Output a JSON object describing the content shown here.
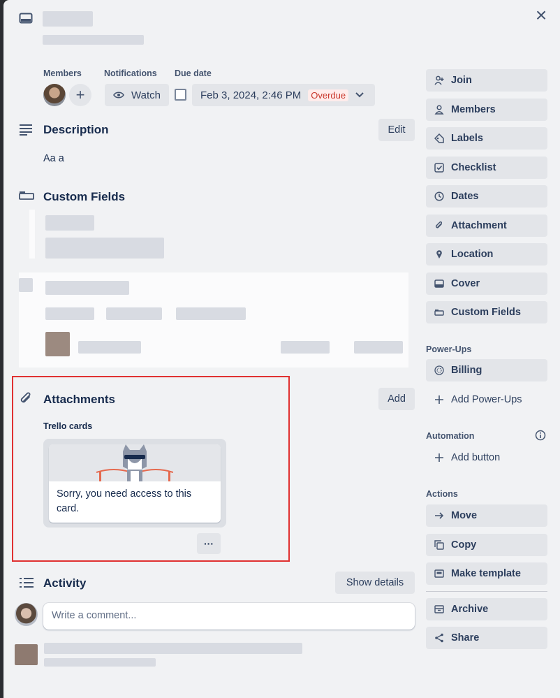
{
  "card": {
    "close_label": "×"
  },
  "header": {
    "members_label": "Members",
    "notifications_label": "Notifications",
    "due_label": "Due date",
    "watch_label": "Watch",
    "due_value": "Feb 3, 2024, 2:46 PM",
    "overdue_badge": "Overdue"
  },
  "description": {
    "title": "Description",
    "edit_label": "Edit",
    "text": "Aa a"
  },
  "custom_fields": {
    "title": "Custom Fields"
  },
  "attachments": {
    "title": "Attachments",
    "add_label": "Add",
    "group_label": "Trello cards",
    "card_message": "Sorry, you need access to this card.",
    "more_label": "···"
  },
  "activity": {
    "title": "Activity",
    "show_details_label": "Show details",
    "comment_placeholder": "Write a comment..."
  },
  "sidebar": {
    "add_to_card": [
      {
        "label": "Join",
        "icon": "add-person-icon"
      },
      {
        "label": "Members",
        "icon": "person-icon"
      },
      {
        "label": "Labels",
        "icon": "tag-icon"
      },
      {
        "label": "Checklist",
        "icon": "checkbox-icon"
      },
      {
        "label": "Dates",
        "icon": "clock-icon"
      },
      {
        "label": "Attachment",
        "icon": "paperclip-icon"
      },
      {
        "label": "Location",
        "icon": "pin-icon"
      },
      {
        "label": "Cover",
        "icon": "cover-icon"
      },
      {
        "label": "Custom Fields",
        "icon": "custom-fields-icon"
      }
    ],
    "powerups_label": "Power-Ups",
    "billing_label": "Billing",
    "add_powerups_label": "Add Power-Ups",
    "automation_label": "Automation",
    "add_button_label": "Add button",
    "actions_label": "Actions",
    "actions": [
      {
        "label": "Move",
        "icon": "arrow-right-icon"
      },
      {
        "label": "Copy",
        "icon": "copy-icon"
      },
      {
        "label": "Make template",
        "icon": "template-icon"
      }
    ],
    "archive_label": "Archive",
    "share_label": "Share"
  },
  "colors": {
    "overdue": "#c9372c",
    "highlight_border": "#e03131",
    "panel_bg": "#f1f2f4",
    "button_bg": "#e3e5e9"
  }
}
